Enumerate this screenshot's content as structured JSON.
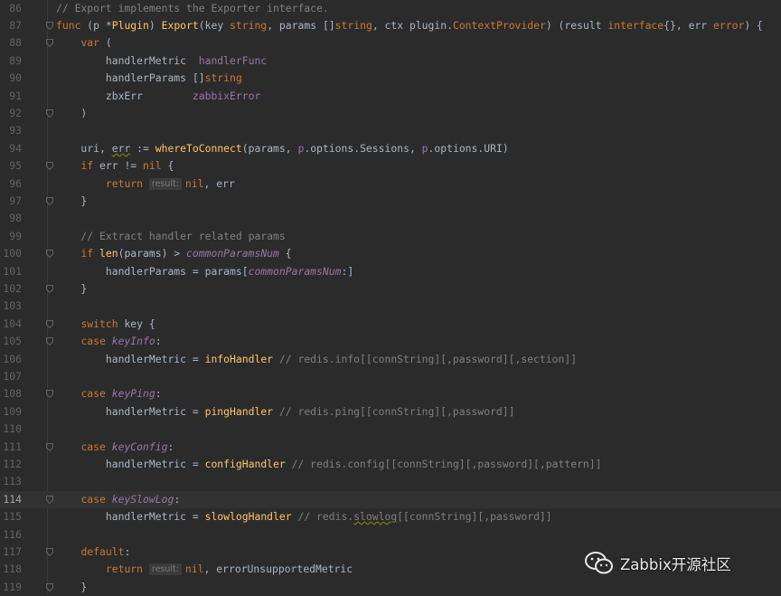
{
  "editor": {
    "current_line": "114",
    "lines": [
      {
        "num": "86",
        "tokens": [
          {
            "t": "// Export implements the Exporter interface.",
            "c": "cm"
          }
        ]
      },
      {
        "num": "87",
        "tokens": [
          {
            "t": "func",
            "c": "kw"
          },
          {
            "t": " (p *"
          },
          {
            "t": "Plugin",
            "c": "fn"
          },
          {
            "t": ") "
          },
          {
            "t": "Export",
            "c": "fn"
          },
          {
            "t": "(key "
          },
          {
            "t": "string",
            "c": "ty"
          },
          {
            "t": ", params []"
          },
          {
            "t": "string",
            "c": "ty"
          },
          {
            "t": ", ctx plugin."
          },
          {
            "t": "ContextProvider",
            "c": "ty"
          },
          {
            "t": ") (result "
          },
          {
            "t": "interface",
            "c": "kw"
          },
          {
            "t": "{}, err "
          },
          {
            "t": "error",
            "c": "ty"
          },
          {
            "t": ") {"
          }
        ]
      },
      {
        "num": "88",
        "tokens": [
          {
            "t": "    "
          },
          {
            "t": "var",
            "c": "kw"
          },
          {
            "t": " ("
          }
        ]
      },
      {
        "num": "89",
        "tokens": [
          {
            "t": "        handlerMetric  "
          },
          {
            "t": "handlerFunc",
            "c": "pu"
          }
        ]
      },
      {
        "num": "90",
        "tokens": [
          {
            "t": "        handlerParams []"
          },
          {
            "t": "string",
            "c": "ty"
          }
        ]
      },
      {
        "num": "91",
        "tokens": [
          {
            "t": "        zbxErr        "
          },
          {
            "t": "zabbixError",
            "c": "pu"
          }
        ]
      },
      {
        "num": "92",
        "tokens": [
          {
            "t": "    )"
          }
        ]
      },
      {
        "num": "93",
        "tokens": []
      },
      {
        "num": "94",
        "tokens": [
          {
            "t": "    uri, "
          },
          {
            "t": "err",
            "c": "wavy"
          },
          {
            "t": " := "
          },
          {
            "t": "whereToConnect",
            "c": "fn"
          },
          {
            "t": "(params, "
          },
          {
            "t": "p",
            "c": "pu"
          },
          {
            "t": ".options.Sessions, "
          },
          {
            "t": "p",
            "c": "pu"
          },
          {
            "t": ".options.URI)"
          }
        ]
      },
      {
        "num": "95",
        "tokens": [
          {
            "t": "    "
          },
          {
            "t": "if",
            "c": "kw"
          },
          {
            "t": " err != "
          },
          {
            "t": "nil",
            "c": "kw"
          },
          {
            "t": " {"
          }
        ]
      },
      {
        "num": "96",
        "tokens": [
          {
            "t": "        "
          },
          {
            "t": "return",
            "c": "kw"
          },
          {
            "t": " "
          },
          {
            "t": "result:",
            "c": "hint"
          },
          {
            "t": "nil",
            "c": "kw"
          },
          {
            "t": ", err"
          }
        ]
      },
      {
        "num": "97",
        "tokens": [
          {
            "t": "    }"
          }
        ]
      },
      {
        "num": "98",
        "tokens": []
      },
      {
        "num": "99",
        "tokens": [
          {
            "t": "    // Extract handler related params",
            "c": "cm"
          }
        ]
      },
      {
        "num": "100",
        "tokens": [
          {
            "t": "    "
          },
          {
            "t": "if",
            "c": "kw"
          },
          {
            "t": " "
          },
          {
            "t": "len",
            "c": "fn"
          },
          {
            "t": "(params) > "
          },
          {
            "t": "commonParamsNum",
            "c": "it"
          },
          {
            "t": " {"
          }
        ]
      },
      {
        "num": "101",
        "tokens": [
          {
            "t": "        handlerParams = params["
          },
          {
            "t": "commonParamsNum",
            "c": "it"
          },
          {
            "t": ":]"
          }
        ]
      },
      {
        "num": "102",
        "tokens": [
          {
            "t": "    }"
          }
        ]
      },
      {
        "num": "103",
        "tokens": []
      },
      {
        "num": "104",
        "tokens": [
          {
            "t": "    "
          },
          {
            "t": "switch",
            "c": "kw"
          },
          {
            "t": " key {"
          }
        ]
      },
      {
        "num": "105",
        "tokens": [
          {
            "t": "    "
          },
          {
            "t": "case",
            "c": "kw"
          },
          {
            "t": " "
          },
          {
            "t": "keyInfo",
            "c": "it"
          },
          {
            "t": ":"
          }
        ]
      },
      {
        "num": "106",
        "tokens": [
          {
            "t": "        handlerMetric = "
          },
          {
            "t": "infoHandler",
            "c": "fn"
          },
          {
            "t": " // redis.info[[connString][,password][,section]]",
            "c": "cm"
          }
        ]
      },
      {
        "num": "107",
        "tokens": []
      },
      {
        "num": "108",
        "tokens": [
          {
            "t": "    "
          },
          {
            "t": "case",
            "c": "kw"
          },
          {
            "t": " "
          },
          {
            "t": "keyPing",
            "c": "it"
          },
          {
            "t": ":"
          }
        ]
      },
      {
        "num": "109",
        "tokens": [
          {
            "t": "        handlerMetric = "
          },
          {
            "t": "pingHandler",
            "c": "fn"
          },
          {
            "t": " // redis.ping[[connString][,password]]",
            "c": "cm"
          }
        ]
      },
      {
        "num": "110",
        "tokens": []
      },
      {
        "num": "111",
        "tokens": [
          {
            "t": "    "
          },
          {
            "t": "case",
            "c": "kw"
          },
          {
            "t": " "
          },
          {
            "t": "keyConfig",
            "c": "it"
          },
          {
            "t": ":"
          }
        ]
      },
      {
        "num": "112",
        "tokens": [
          {
            "t": "        handlerMetric = "
          },
          {
            "t": "configHandler",
            "c": "fn"
          },
          {
            "t": " // redis.config[[connString][,password][,pattern]]",
            "c": "cm"
          }
        ]
      },
      {
        "num": "113",
        "tokens": []
      },
      {
        "num": "114",
        "tokens": [
          {
            "t": "    "
          },
          {
            "t": "case",
            "c": "kw"
          },
          {
            "t": " "
          },
          {
            "t": "keySlowLog",
            "c": "it"
          },
          {
            "t": ":"
          }
        ]
      },
      {
        "num": "115",
        "tokens": [
          {
            "t": "        handlerMetric = "
          },
          {
            "t": "slowlogHandler",
            "c": "fn"
          },
          {
            "t": " // redis.",
            "c": "cm"
          },
          {
            "t": "slowlog",
            "c": "cm wavy"
          },
          {
            "t": "[[connString][,password]]",
            "c": "cm"
          }
        ]
      },
      {
        "num": "116",
        "tokens": []
      },
      {
        "num": "117",
        "tokens": [
          {
            "t": "    "
          },
          {
            "t": "default",
            "c": "kw"
          },
          {
            "t": ":"
          }
        ]
      },
      {
        "num": "118",
        "tokens": [
          {
            "t": "        "
          },
          {
            "t": "return",
            "c": "kw"
          },
          {
            "t": " "
          },
          {
            "t": "result:",
            "c": "hint"
          },
          {
            "t": "nil",
            "c": "kw"
          },
          {
            "t": ", errorUnsupportedMetric"
          }
        ]
      },
      {
        "num": "119",
        "tokens": [
          {
            "t": "    }"
          }
        ]
      }
    ]
  },
  "watermark": {
    "text": "Zabbix开源社区",
    "icon": "wechat-icon"
  },
  "colors": {
    "background": "#2b2b2b",
    "keyword": "#cc7832",
    "function": "#ffc66d",
    "comment": "#808080",
    "constant": "#9876aa",
    "text": "#a9b7c6",
    "line_number": "#606366"
  }
}
